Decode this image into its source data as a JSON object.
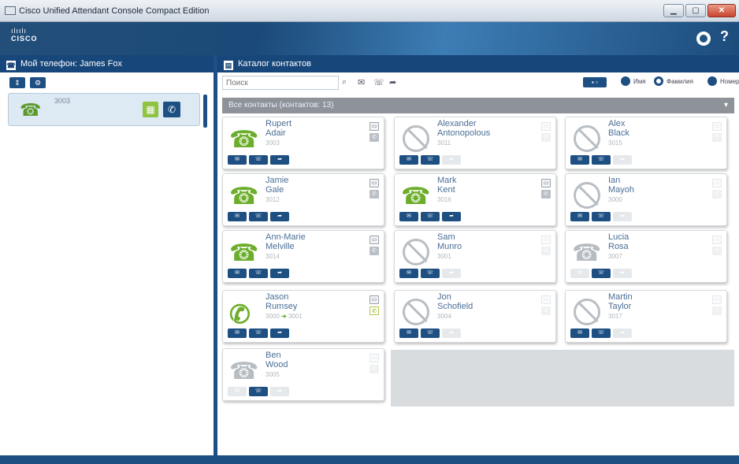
{
  "window": {
    "title": "Cisco Unified Attendant Console Compact Edition",
    "min": "▁",
    "max": "▢",
    "close": "✕"
  },
  "brand": {
    "dots": "ılıılı",
    "word": "CISCO"
  },
  "header": {
    "help": "?"
  },
  "left": {
    "title": "Мой телефон: James Fox",
    "phone": {
      "number": "3003"
    }
  },
  "right": {
    "title": "Каталог контактов",
    "search_placeholder": "Поиск",
    "view_label": "▪ ▫",
    "radios": [
      {
        "label": "Имя"
      },
      {
        "label": "Фамилия"
      },
      {
        "label": "Номер"
      }
    ],
    "group": {
      "title": "Все контакты (контактов: 13)"
    }
  },
  "contacts": [
    {
      "first": "Rupert",
      "last": "Adair",
      "ext": "3003",
      "status": "available"
    },
    {
      "first": "Alexander",
      "last": "Antonopolous",
      "ext": "3011",
      "status": "dnd"
    },
    {
      "first": "Alex",
      "last": "Black",
      "ext": "3015",
      "status": "dnd"
    },
    {
      "first": "Jamie",
      "last": "Gale",
      "ext": "3012",
      "status": "available"
    },
    {
      "first": "Mark",
      "last": "Kent",
      "ext": "3016",
      "status": "available"
    },
    {
      "first": "Ian",
      "last": "Mayoh",
      "ext": "3000",
      "status": "dnd"
    },
    {
      "first": "Ann-Marie",
      "last": "Melville",
      "ext": "3014",
      "status": "available"
    },
    {
      "first": "Sam",
      "last": "Munro",
      "ext": "3001",
      "status": "dnd"
    },
    {
      "first": "Lucia",
      "last": "Rosa",
      "ext": "3007",
      "status": "offline"
    },
    {
      "first": "Jason",
      "last": "Rumsey",
      "ext": "3000",
      "ext_to": "3001",
      "status": "oncall"
    },
    {
      "first": "Jon",
      "last": "Schofield",
      "ext": "3004",
      "status": "dnd"
    },
    {
      "first": "Martin",
      "last": "Taylor",
      "ext": "3017",
      "status": "dnd"
    },
    {
      "first": "Ben",
      "last": "Wood",
      "ext": "3005",
      "status": "offline"
    }
  ],
  "colors": {
    "accent": "#1d4f82",
    "available": "#6cae2b",
    "offline": "#b6bcc2"
  },
  "icons": {
    "available": "phone-green-icon",
    "dnd": "do-not-disturb-icon",
    "offline": "phone-gray-icon",
    "oncall": "handset-active-icon"
  }
}
